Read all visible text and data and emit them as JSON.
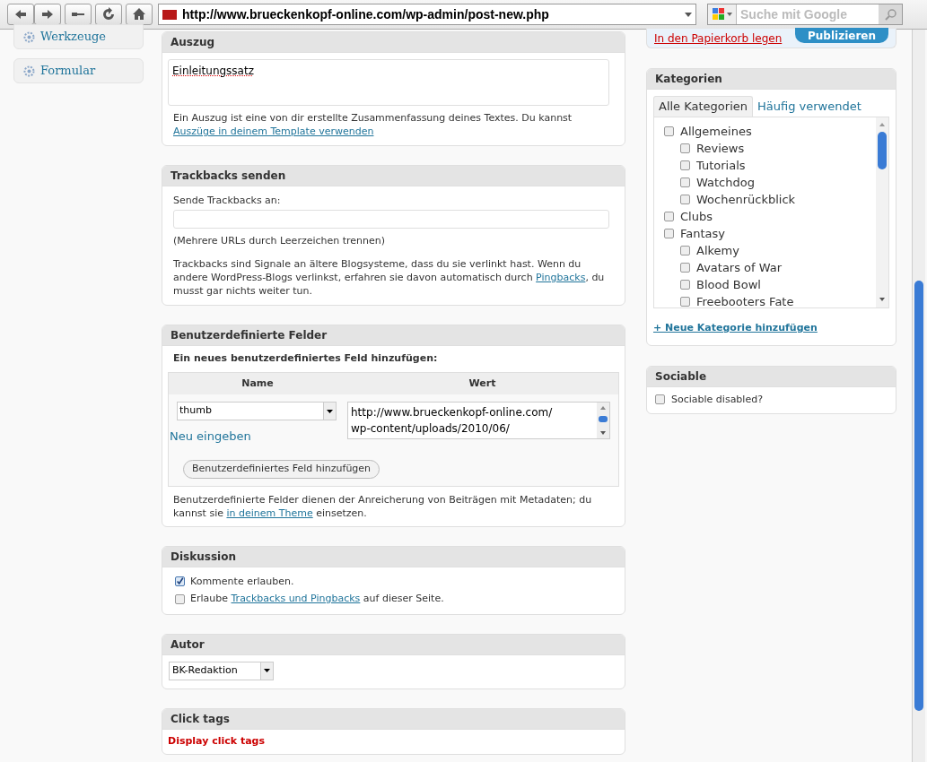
{
  "browser": {
    "url": "http://www.brueckenkopf-online.com/wp-admin/post-new.php",
    "search_placeholder": "Suche mit Google"
  },
  "sidebar": {
    "items": [
      {
        "label": "Werkzeuge"
      },
      {
        "label": "Formular"
      }
    ]
  },
  "publish": {
    "trash_link": "In den Papierkorb legen",
    "publish_button": "Publizieren"
  },
  "excerpt": {
    "title": "Auszug",
    "value": "Einleitungssatz",
    "help_text": "Ein Auszug ist eine von dir erstellte Zusammenfassung deines Textes. Du kannst",
    "help_link": "Auszüge in deinem Template verwenden"
  },
  "trackbacks": {
    "title": "Trackbacks senden",
    "label": "Sende Trackbacks an:",
    "hint": "(Mehrere URLs durch Leerzeichen trennen)",
    "description": "Trackbacks sind Signale an ältere Blogsysteme, dass du sie verlinkt hast. Wenn du andere WordPress-Blogs verlinkst, erfahren sie davon automatisch durch",
    "link": "Pingbacks",
    "description_end": ", du musst gar nichts weiter tun."
  },
  "custom_fields": {
    "title": "Benutzerdefinierte Felder",
    "subtitle": "Ein neues benutzerdefiniertes Feld hinzufügen:",
    "columns": [
      "Name",
      "Wert"
    ],
    "name_value": "thumb",
    "new_link": "Neu eingeben",
    "value": "http://www.brueckenkopf-online.com/\nwp-content/uploads/2010/06/",
    "add_button": "Benutzerdefiniertes Feld hinzufügen",
    "help": "Benutzerdefinierte Felder dienen der Anreicherung von Beiträgen mit Metadaten; du kannst sie",
    "help_link": "in deinem Theme",
    "help_end": "einsetzen."
  },
  "discussion": {
    "title": "Diskussion",
    "options": [
      {
        "checked": true,
        "text": "Kommente erlauben."
      },
      {
        "checked": false,
        "text": "Erlaube",
        "link": "Trackbacks und Pingbacks",
        "text_end": "auf dieser Seite."
      }
    ]
  },
  "author": {
    "title": "Autor",
    "value": "BK-Redaktion"
  },
  "click_tags": {
    "title": "Click tags",
    "link": "Display click tags"
  },
  "categories": {
    "title": "Kategorien",
    "tabs": [
      {
        "label": "Alle Kategorien",
        "selected": true
      },
      {
        "label": "Häufig verwendet",
        "selected": false
      }
    ],
    "items": [
      {
        "label": "Allgemeines",
        "checked": false,
        "children": [
          {
            "label": "Reviews",
            "checked": false
          },
          {
            "label": "Tutorials",
            "checked": false
          },
          {
            "label": "Watchdog",
            "checked": false
          },
          {
            "label": "Wochenrückblick",
            "checked": false
          }
        ]
      },
      {
        "label": "Clubs",
        "checked": false
      },
      {
        "label": "Fantasy",
        "checked": false,
        "children": [
          {
            "label": "Alkemy",
            "checked": false
          },
          {
            "label": "Avatars of War",
            "checked": false
          },
          {
            "label": "Blood Bowl",
            "checked": false
          },
          {
            "label": "Freebooters Fate",
            "checked": false
          }
        ]
      }
    ],
    "add_link": "+ Neue Kategorie hinzufügen"
  },
  "sociable": {
    "title": "Sociable",
    "options": [
      {
        "label": "Sociable disabled?",
        "checked": false
      }
    ]
  }
}
